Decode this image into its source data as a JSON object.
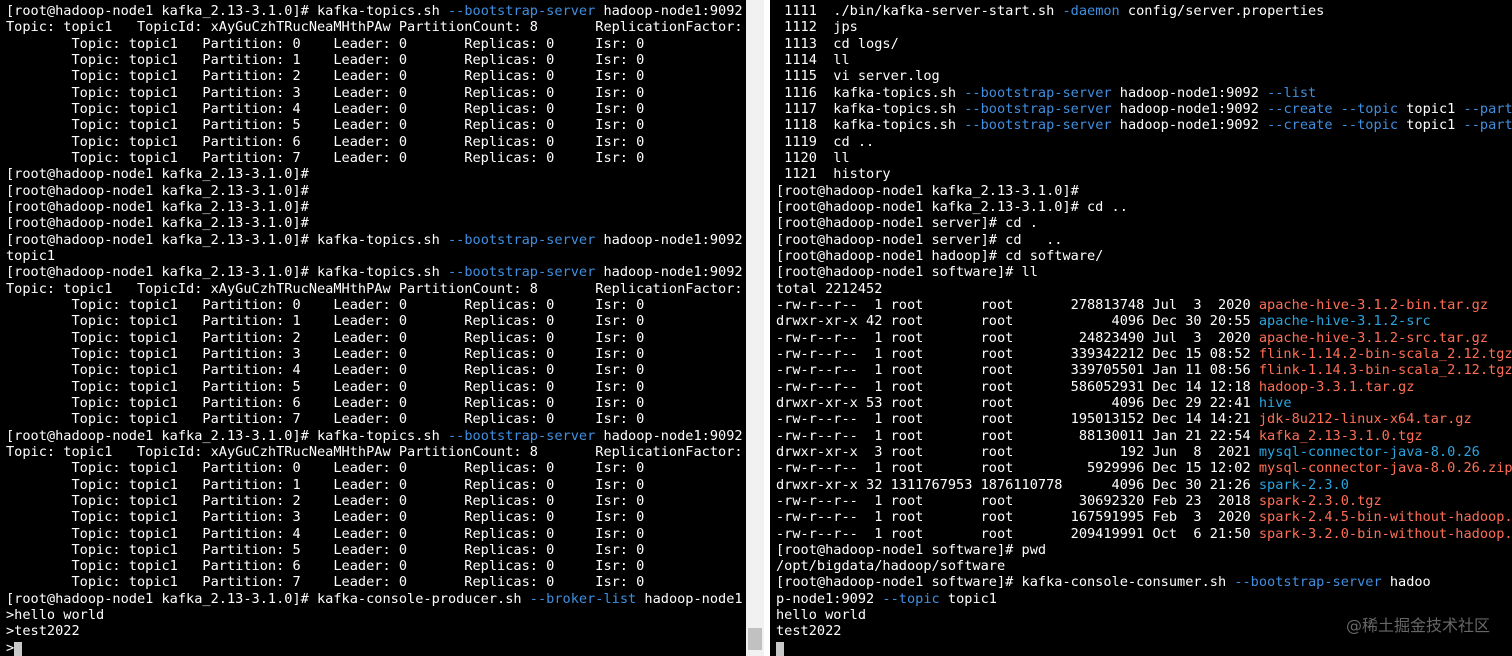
{
  "colors": {
    "terminal_bg": "#000000",
    "text": "#ffffff",
    "option_blue": "#3f8fe0",
    "directory_cyan": "#2aa5e0",
    "archive_red": "#ff6e55"
  },
  "left_terminal": {
    "lines": [
      [
        {
          "t": "[root@hadoop-node1 kafka_2.13-3.1.0]# kafka-topics.sh "
        },
        {
          "t": "--bootstrap-server",
          "c": "opt"
        },
        {
          "t": " hadoop-node1:9092"
        }
      ],
      [
        {
          "t": "Topic: topic1   TopicId: xAyGuCzhTRucNeaMHthPAw PartitionCount: 8       ReplicationFactor:"
        }
      ],
      [
        {
          "t": "        Topic: topic1   Partition: 0    Leader: 0       Replicas: 0     Isr: 0"
        }
      ],
      [
        {
          "t": "        Topic: topic1   Partition: 1    Leader: 0       Replicas: 0     Isr: 0"
        }
      ],
      [
        {
          "t": "        Topic: topic1   Partition: 2    Leader: 0       Replicas: 0     Isr: 0"
        }
      ],
      [
        {
          "t": "        Topic: topic1   Partition: 3    Leader: 0       Replicas: 0     Isr: 0"
        }
      ],
      [
        {
          "t": "        Topic: topic1   Partition: 4    Leader: 0       Replicas: 0     Isr: 0"
        }
      ],
      [
        {
          "t": "        Topic: topic1   Partition: 5    Leader: 0       Replicas: 0     Isr: 0"
        }
      ],
      [
        {
          "t": "        Topic: topic1   Partition: 6    Leader: 0       Replicas: 0     Isr: 0"
        }
      ],
      [
        {
          "t": "        Topic: topic1   Partition: 7    Leader: 0       Replicas: 0     Isr: 0"
        }
      ],
      [
        {
          "t": "[root@hadoop-node1 kafka_2.13-3.1.0]#"
        }
      ],
      [
        {
          "t": "[root@hadoop-node1 kafka_2.13-3.1.0]#"
        }
      ],
      [
        {
          "t": "[root@hadoop-node1 kafka_2.13-3.1.0]#"
        }
      ],
      [
        {
          "t": "[root@hadoop-node1 kafka_2.13-3.1.0]#"
        }
      ],
      [
        {
          "t": "[root@hadoop-node1 kafka_2.13-3.1.0]# kafka-topics.sh "
        },
        {
          "t": "--bootstrap-server",
          "c": "opt"
        },
        {
          "t": " hadoop-node1:9092"
        }
      ],
      [
        {
          "t": "topic1"
        }
      ],
      [
        {
          "t": "[root@hadoop-node1 kafka_2.13-3.1.0]# kafka-topics.sh "
        },
        {
          "t": "--bootstrap-server",
          "c": "opt"
        },
        {
          "t": " hadoop-node1:9092"
        }
      ],
      [
        {
          "t": "Topic: topic1   TopicId: xAyGuCzhTRucNeaMHthPAw PartitionCount: 8       ReplicationFactor:"
        }
      ],
      [
        {
          "t": "        Topic: topic1   Partition: 0    Leader: 0       Replicas: 0     Isr: 0"
        }
      ],
      [
        {
          "t": "        Topic: topic1   Partition: 1    Leader: 0       Replicas: 0     Isr: 0"
        }
      ],
      [
        {
          "t": "        Topic: topic1   Partition: 2    Leader: 0       Replicas: 0     Isr: 0"
        }
      ],
      [
        {
          "t": "        Topic: topic1   Partition: 3    Leader: 0       Replicas: 0     Isr: 0"
        }
      ],
      [
        {
          "t": "        Topic: topic1   Partition: 4    Leader: 0       Replicas: 0     Isr: 0"
        }
      ],
      [
        {
          "t": "        Topic: topic1   Partition: 5    Leader: 0       Replicas: 0     Isr: 0"
        }
      ],
      [
        {
          "t": "        Topic: topic1   Partition: 6    Leader: 0       Replicas: 0     Isr: 0"
        }
      ],
      [
        {
          "t": "        Topic: topic1   Partition: 7    Leader: 0       Replicas: 0     Isr: 0"
        }
      ],
      [
        {
          "t": "[root@hadoop-node1 kafka_2.13-3.1.0]# kafka-topics.sh "
        },
        {
          "t": "--bootstrap-server",
          "c": "opt"
        },
        {
          "t": " hadoop-node1:9092"
        }
      ],
      [
        {
          "t": "Topic: topic1   TopicId: xAyGuCzhTRucNeaMHthPAw PartitionCount: 8       ReplicationFactor:"
        }
      ],
      [
        {
          "t": "        Topic: topic1   Partition: 0    Leader: 0       Replicas: 0     Isr: 0"
        }
      ],
      [
        {
          "t": "        Topic: topic1   Partition: 1    Leader: 0       Replicas: 0     Isr: 0"
        }
      ],
      [
        {
          "t": "        Topic: topic1   Partition: 2    Leader: 0       Replicas: 0     Isr: 0"
        }
      ],
      [
        {
          "t": "        Topic: topic1   Partition: 3    Leader: 0       Replicas: 0     Isr: 0"
        }
      ],
      [
        {
          "t": "        Topic: topic1   Partition: 4    Leader: 0       Replicas: 0     Isr: 0"
        }
      ],
      [
        {
          "t": "        Topic: topic1   Partition: 5    Leader: 0       Replicas: 0     Isr: 0"
        }
      ],
      [
        {
          "t": "        Topic: topic1   Partition: 6    Leader: 0       Replicas: 0     Isr: 0"
        }
      ],
      [
        {
          "t": "        Topic: topic1   Partition: 7    Leader: 0       Replicas: 0     Isr: 0"
        }
      ],
      [
        {
          "t": "[root@hadoop-node1 kafka_2.13-3.1.0]# kafka-console-producer.sh "
        },
        {
          "t": "--broker-list",
          "c": "opt"
        },
        {
          "t": " hadoop-node1"
        }
      ],
      [
        {
          "t": ">hello world"
        }
      ],
      [
        {
          "t": ">test2022"
        }
      ],
      [
        {
          "t": ">"
        },
        {
          "cursor": true
        }
      ]
    ]
  },
  "right_terminal": {
    "lines": [
      [
        {
          "t": " 1111  ./bin/kafka-server-start.sh "
        },
        {
          "t": "-daemon",
          "c": "opt"
        },
        {
          "t": " config/server.properties"
        }
      ],
      [
        {
          "t": " 1112  jps"
        }
      ],
      [
        {
          "t": " 1113  cd logs/"
        }
      ],
      [
        {
          "t": " 1114  ll"
        }
      ],
      [
        {
          "t": " 1115  vi server.log"
        }
      ],
      [
        {
          "t": " 1116  kafka-topics.sh "
        },
        {
          "t": "--bootstrap-server",
          "c": "opt"
        },
        {
          "t": " hadoop-node1:9092 "
        },
        {
          "t": "--list",
          "c": "opt"
        }
      ],
      [
        {
          "t": " 1117  kafka-topics.sh "
        },
        {
          "t": "--bootstrap-server",
          "c": "opt"
        },
        {
          "t": " hadoop-node1:9092 "
        },
        {
          "t": "--create",
          "c": "opt"
        },
        {
          "t": " "
        },
        {
          "t": "--topic",
          "c": "opt"
        },
        {
          "t": " topic1 "
        },
        {
          "t": "--part",
          "c": "opt"
        }
      ],
      [
        {
          "t": " 1118  kafka-topics.sh "
        },
        {
          "t": "--bootstrap-server",
          "c": "opt"
        },
        {
          "t": " hadoop-node1:9092 "
        },
        {
          "t": "--create",
          "c": "opt"
        },
        {
          "t": " "
        },
        {
          "t": "--topic",
          "c": "opt"
        },
        {
          "t": " topic1 "
        },
        {
          "t": "--part",
          "c": "opt"
        }
      ],
      [
        {
          "t": " 1119  cd .."
        }
      ],
      [
        {
          "t": " 1120  ll"
        }
      ],
      [
        {
          "t": " 1121  history"
        }
      ],
      [
        {
          "t": "[root@hadoop-node1 kafka_2.13-3.1.0]#"
        }
      ],
      [
        {
          "t": "[root@hadoop-node1 kafka_2.13-3.1.0]# cd .."
        }
      ],
      [
        {
          "t": "[root@hadoop-node1 server]# cd ."
        }
      ],
      [
        {
          "t": "[root@hadoop-node1 server]# cd   .."
        }
      ],
      [
        {
          "t": "[root@hadoop-node1 hadoop]# cd software/"
        }
      ],
      [
        {
          "t": "[root@hadoop-node1 software]# ll"
        }
      ],
      [
        {
          "t": "total 2212452"
        }
      ],
      [
        {
          "t": "-rw-r--r--  1 root       root       278813748 Jul  3  2020 "
        },
        {
          "t": "apache-hive-3.1.2-bin.tar.gz",
          "c": "arc"
        }
      ],
      [
        {
          "t": "drwxr-xr-x 42 root       root            4096 Dec 30 20:55 "
        },
        {
          "t": "apache-hive-3.1.2-src",
          "c": "dir"
        }
      ],
      [
        {
          "t": "-rw-r--r--  1 root       root        24823490 Jul  3  2020 "
        },
        {
          "t": "apache-hive-3.1.2-src.tar.gz",
          "c": "arc"
        }
      ],
      [
        {
          "t": "-rw-r--r--  1 root       root       339342212 Dec 15 08:52 "
        },
        {
          "t": "flink-1.14.2-bin-scala_2.12.tgz",
          "c": "arc"
        }
      ],
      [
        {
          "t": "-rw-r--r--  1 root       root       339705501 Jan 11 08:56 "
        },
        {
          "t": "flink-1.14.3-bin-scala_2.12.tgz",
          "c": "arc"
        }
      ],
      [
        {
          "t": "-rw-r--r--  1 root       root       586052931 Dec 14 12:18 "
        },
        {
          "t": "hadoop-3.3.1.tar.gz",
          "c": "arc"
        }
      ],
      [
        {
          "t": "drwxr-xr-x 53 root       root            4096 Dec 29 22:41 "
        },
        {
          "t": "hive",
          "c": "dir"
        }
      ],
      [
        {
          "t": "-rw-r--r--  1 root       root       195013152 Dec 14 14:21 "
        },
        {
          "t": "jdk-8u212-linux-x64.tar.gz",
          "c": "arc"
        }
      ],
      [
        {
          "t": "-rw-r--r--  1 root       root        88130011 Jan 21 22:54 "
        },
        {
          "t": "kafka_2.13-3.1.0.tgz",
          "c": "arc"
        }
      ],
      [
        {
          "t": "drwxr-xr-x  3 root       root             192 Jun  8  2021 "
        },
        {
          "t": "mysql-connector-java-8.0.26",
          "c": "dir"
        }
      ],
      [
        {
          "t": "-rw-r--r--  1 root       root         5929996 Dec 15 12:02 "
        },
        {
          "t": "mysql-connector-java-8.0.26.zip",
          "c": "arc"
        }
      ],
      [
        {
          "t": "drwxr-xr-x 32 1311767953 1876110778      4096 Dec 30 21:26 "
        },
        {
          "t": "spark-2.3.0",
          "c": "dir"
        }
      ],
      [
        {
          "t": "-rw-r--r--  1 root       root        30692320 Feb 23  2018 "
        },
        {
          "t": "spark-2.3.0.tgz",
          "c": "arc"
        }
      ],
      [
        {
          "t": "-rw-r--r--  1 root       root       167591995 Feb  3  2020 "
        },
        {
          "t": "spark-2.4.5-bin-without-hadoop.",
          "c": "arc"
        }
      ],
      [
        {
          "t": "-rw-r--r--  1 root       root       209419991 Oct  6 21:50 "
        },
        {
          "t": "spark-3.2.0-bin-without-hadoop.",
          "c": "arc"
        }
      ],
      [
        {
          "t": "[root@hadoop-node1 software]# pwd"
        }
      ],
      [
        {
          "t": "/opt/bigdata/hadoop/software"
        }
      ],
      [
        {
          "t": "[root@hadoop-node1 software]# kafka-console-consumer.sh "
        },
        {
          "t": "--bootstrap-server",
          "c": "opt"
        },
        {
          "t": " hadoo"
        }
      ],
      [
        {
          "t": "p-node1:9092 "
        },
        {
          "t": "--topic",
          "c": "opt"
        },
        {
          "t": " topic1"
        }
      ],
      [
        {
          "t": "hello world"
        }
      ],
      [
        {
          "t": "test2022"
        }
      ],
      [
        {
          "cursor": true
        }
      ]
    ]
  },
  "watermark": "@稀土掘金技术社区"
}
